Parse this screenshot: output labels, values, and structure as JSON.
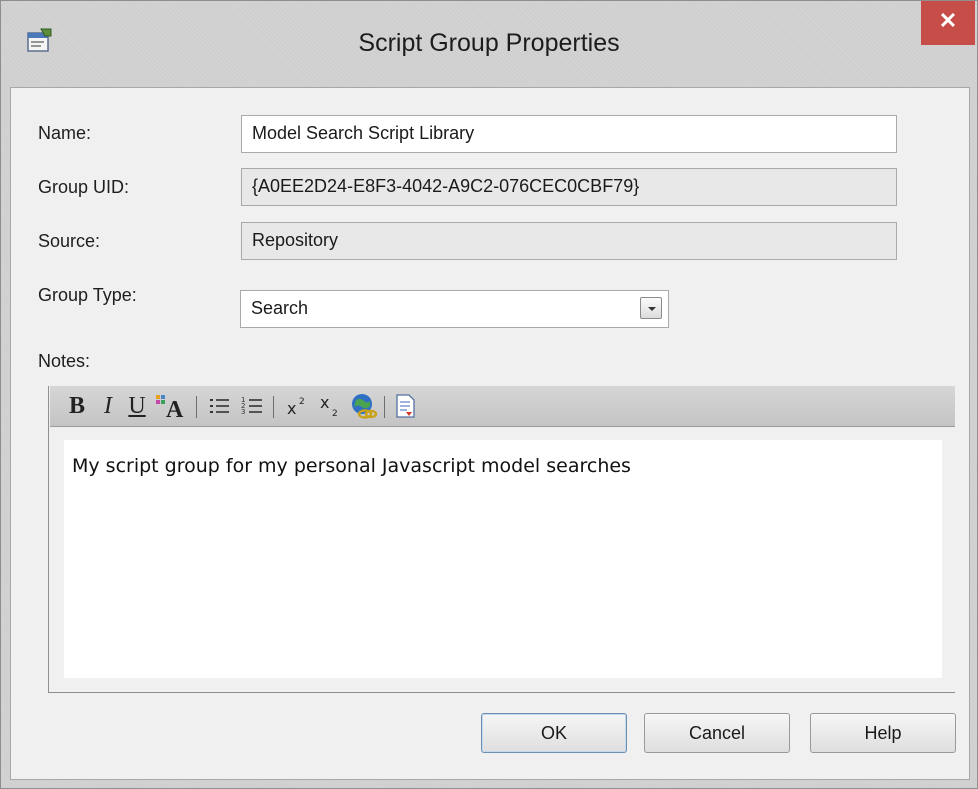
{
  "window": {
    "title": "Script Group Properties",
    "close_glyph": "✕",
    "icon": "properties-window-icon"
  },
  "form": {
    "name_label": "Name:",
    "name_value": "Model Search Script Library",
    "uid_label": "Group UID:",
    "uid_value": "{A0EE2D24-E8F3-4042-A9C2-076CEC0CBF79}",
    "source_label": "Source:",
    "source_value": "Repository",
    "type_label": "Group Type:",
    "type_value": "Search",
    "notes_label": "Notes:"
  },
  "toolbar": {
    "bold": "B",
    "italic": "I",
    "underline": "U",
    "font_color": "A",
    "bullet_list": "bullet-list-icon",
    "numbered_list": "numbered-list-icon",
    "superscript": "x",
    "subscript": "x",
    "hyperlink": "hyperlink-icon",
    "document": "document-icon"
  },
  "notes": {
    "text": "My script group for my personal Javascript model searches"
  },
  "buttons": {
    "ok": "OK",
    "cancel": "Cancel",
    "help": "Help"
  },
  "colors": {
    "close_button": "#c74d48",
    "frame": "#cfcfcf",
    "client": "#f0f0f0"
  }
}
